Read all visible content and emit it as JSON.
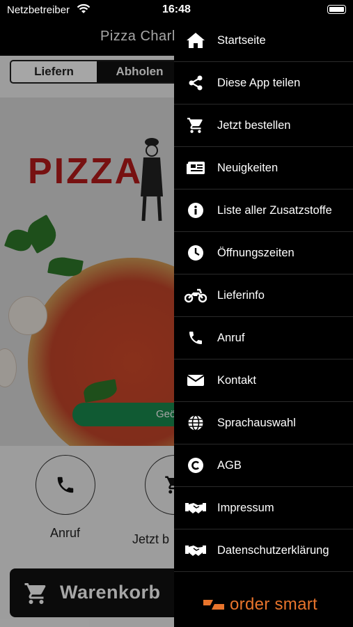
{
  "status_bar": {
    "carrier": "Netzbetreiber",
    "time": "16:48"
  },
  "header": {
    "title": "Pizza Charlc"
  },
  "order_mode": {
    "delivery": "Liefern",
    "pickup": "Abholen",
    "selected": "Abholen"
  },
  "hero": {
    "logo_text": "PIZZA",
    "opening_button": "Geö"
  },
  "actions": {
    "call": "Anruf",
    "order": "Jetzt b"
  },
  "cart": {
    "label": "Warenkorb"
  },
  "menu": {
    "items": [
      {
        "label": "Startseite",
        "icon": "home-icon"
      },
      {
        "label": "Diese App teilen",
        "icon": "share-icon"
      },
      {
        "label": "Jetzt bestellen",
        "icon": "cart-icon"
      },
      {
        "label": "Neuigkeiten",
        "icon": "news-icon"
      },
      {
        "label": "Liste aller Zusatzstoffe",
        "icon": "info-icon"
      },
      {
        "label": "Öffnungszeiten",
        "icon": "clock-icon"
      },
      {
        "label": "Lieferinfo",
        "icon": "motorcycle-icon"
      },
      {
        "label": "Anruf",
        "icon": "phone-icon"
      },
      {
        "label": "Kontakt",
        "icon": "mail-icon"
      },
      {
        "label": "Sprachauswahl",
        "icon": "globe-icon"
      },
      {
        "label": "AGB",
        "icon": "copyright-icon"
      },
      {
        "label": "Impressum",
        "icon": "handshake-icon"
      },
      {
        "label": "Datenschutzerklärung",
        "icon": "handshake-icon"
      }
    ],
    "brand": "order smart"
  },
  "colors": {
    "accent_green": "#1a8a4f",
    "brand_orange": "#e8742c",
    "logo_red": "#b71b1b"
  }
}
